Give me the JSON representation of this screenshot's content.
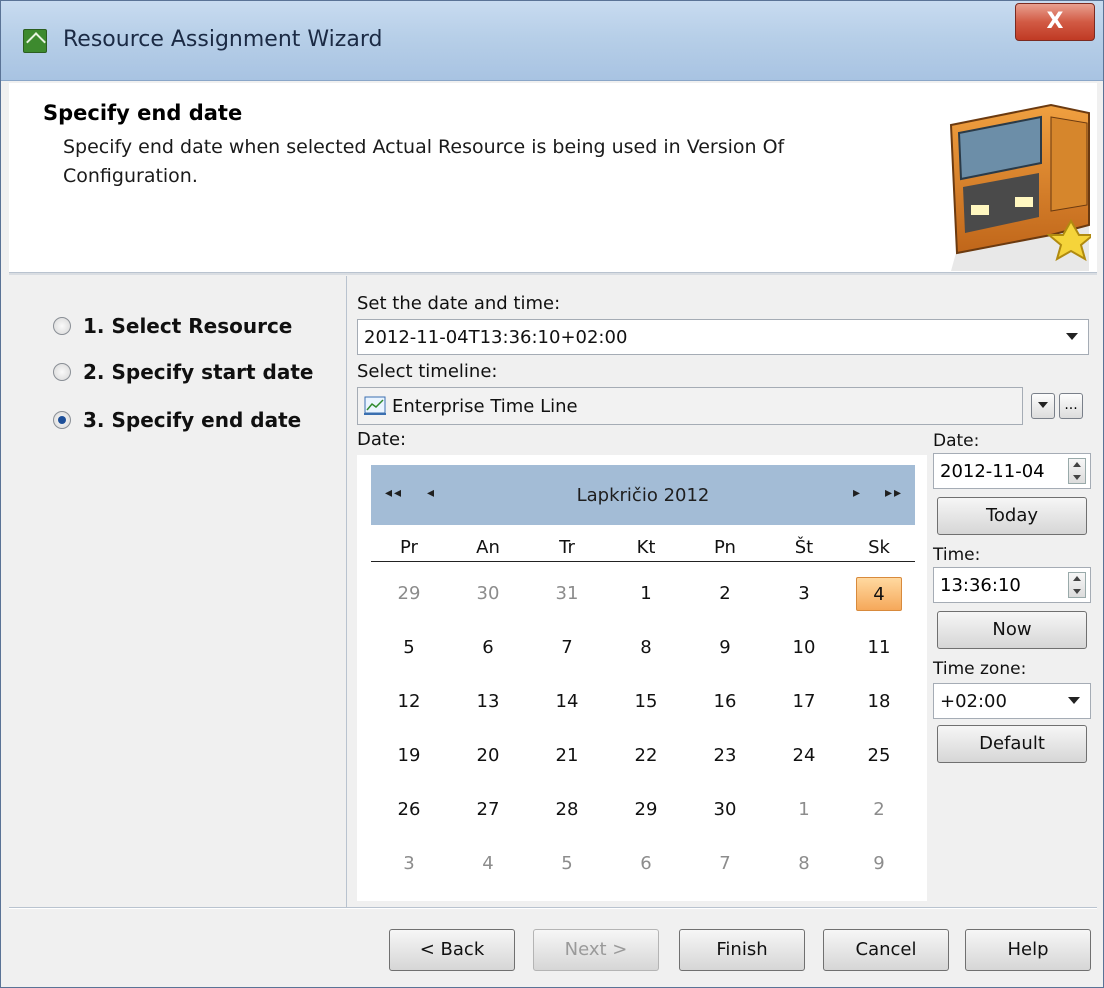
{
  "window": {
    "title": "Resource Assignment Wizard",
    "close_label": "X"
  },
  "header": {
    "title": "Specify end date",
    "description": "Specify end date when selected Actual Resource is being used in Version Of Configuration."
  },
  "steps": [
    {
      "label": "1. Select Resource",
      "selected": false
    },
    {
      "label": "2. Specify start date",
      "selected": false
    },
    {
      "label": "3. Specify end date",
      "selected": true
    }
  ],
  "datetime": {
    "label": "Set the date and time:",
    "value": "2012-11-04T13:36:10+02:00"
  },
  "timeline": {
    "label": "Select timeline:",
    "value": "Enterprise Time Line",
    "more_label": "..."
  },
  "calendar": {
    "label": "Date:",
    "prev_year": "◂◂",
    "prev_month": "◂",
    "next_month": "▸",
    "next_year": "▸▸",
    "month_title": "Lapkričio  2012",
    "weekdays": [
      "Pr",
      "An",
      "Tr",
      "Kt",
      "Pn",
      "Št",
      "Sk"
    ],
    "weeks": [
      [
        "29",
        "30",
        "31",
        "1",
        "2",
        "3",
        "4"
      ],
      [
        "5",
        "6",
        "7",
        "8",
        "9",
        "10",
        "11"
      ],
      [
        "12",
        "13",
        "14",
        "15",
        "16",
        "17",
        "18"
      ],
      [
        "19",
        "20",
        "21",
        "22",
        "23",
        "24",
        "25"
      ],
      [
        "26",
        "27",
        "28",
        "29",
        "30",
        "1",
        "2"
      ],
      [
        "3",
        "4",
        "5",
        "6",
        "7",
        "8",
        "9"
      ]
    ],
    "selected": "4"
  },
  "side": {
    "date_label": "Date:",
    "date_value": "2012-11-04",
    "today_label": "Today",
    "time_label": "Time:",
    "time_value": "13:36:10",
    "now_label": "Now",
    "tz_label": "Time zone:",
    "tz_value": "+02:00",
    "default_label": "Default"
  },
  "footer": {
    "back": "< Back",
    "next": "Next >",
    "finish": "Finish",
    "cancel": "Cancel",
    "help": "Help"
  },
  "colors": {
    "title_bar": "#b7cfe8",
    "calendar_header": "#a3bcd6",
    "selected_day": "#f5a85a"
  }
}
